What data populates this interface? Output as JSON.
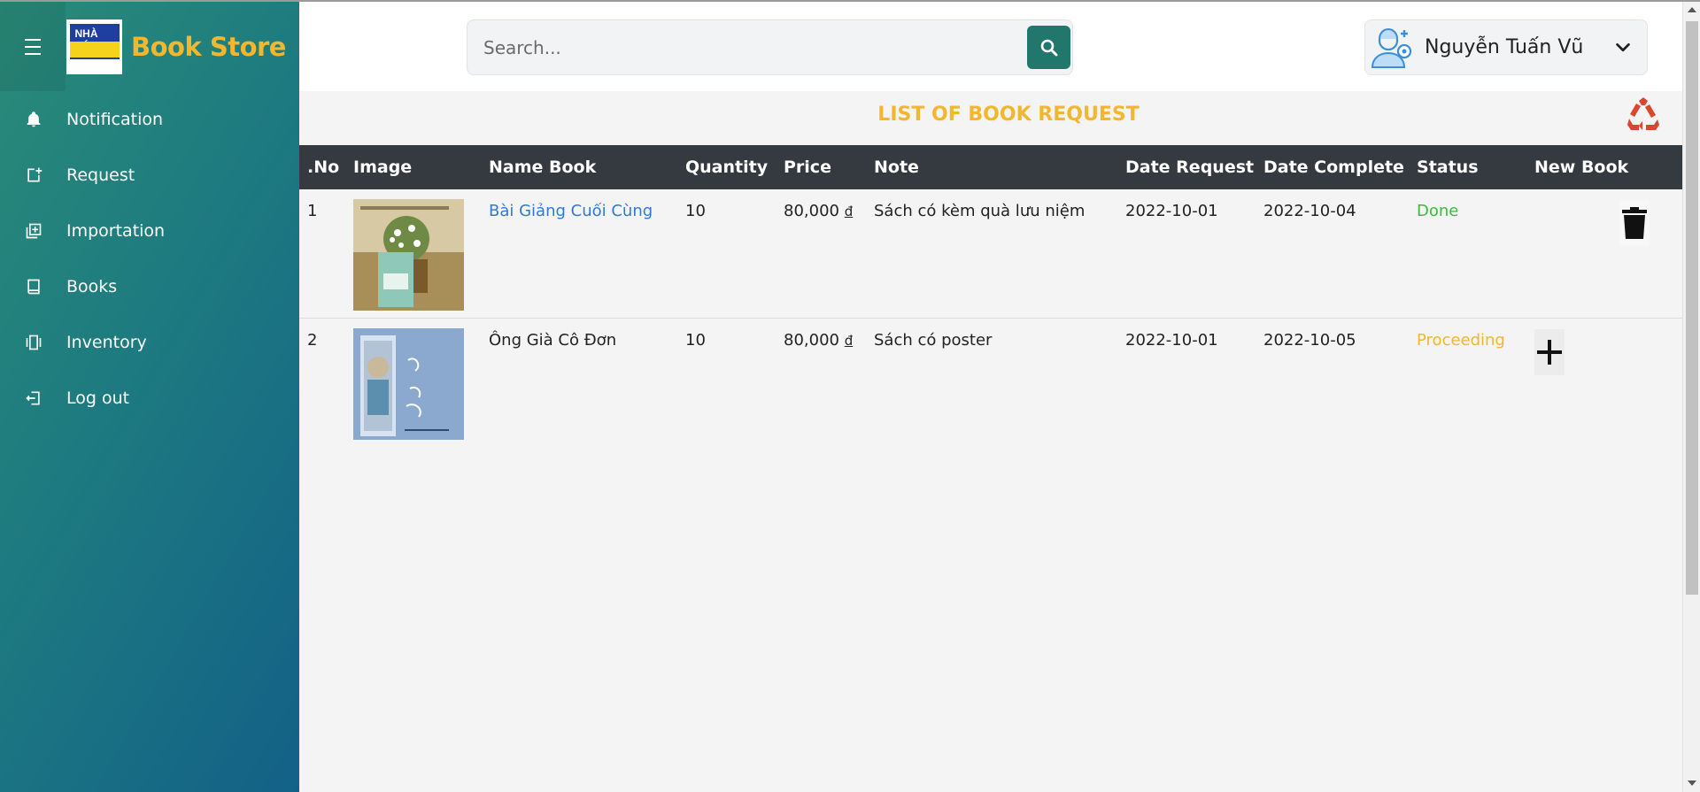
{
  "app": {
    "brand": "Book Store",
    "logo_text": "NHÀ SÁCH"
  },
  "sidebar": {
    "items": [
      {
        "label": "Notification",
        "icon": "bell-icon"
      },
      {
        "label": "Request",
        "icon": "request-icon"
      },
      {
        "label": "Importation",
        "icon": "import-icon"
      },
      {
        "label": "Books",
        "icon": "book-icon"
      },
      {
        "label": "Inventory",
        "icon": "inventory-icon"
      },
      {
        "label": "Log out",
        "icon": "logout-icon"
      }
    ]
  },
  "search": {
    "placeholder": "Search..."
  },
  "user": {
    "name": "Nguyễn Tuấn Vũ"
  },
  "page": {
    "title": "LIST OF BOOK REQUEST"
  },
  "table": {
    "headers": [
      ".No",
      "Image",
      "Name Book",
      "Quantity",
      "Price",
      "Note",
      "Date Request",
      "Date Complete",
      "Status",
      "New Book"
    ],
    "rows": [
      {
        "no": "1",
        "name": "Bài Giảng Cuối Cùng",
        "quantity": "10",
        "price": "80,000",
        "currency": "đ",
        "note": "Sách có kèm quà lưu niệm",
        "date_request": "2022-10-01",
        "date_complete": "2022-10-04",
        "status": "Done"
      },
      {
        "no": "2",
        "name": "Ông Già Cô Đơn",
        "quantity": "10",
        "price": "80,000",
        "currency": "đ",
        "note": "Sách có poster",
        "date_request": "2022-10-01",
        "date_complete": "2022-10-05",
        "status": "Proceeding"
      }
    ]
  },
  "colors": {
    "accent": "#f2b72e",
    "done": "#3bbb3b",
    "link": "#2f7ad8",
    "search_button": "#22776c",
    "table_header": "#353a40"
  }
}
